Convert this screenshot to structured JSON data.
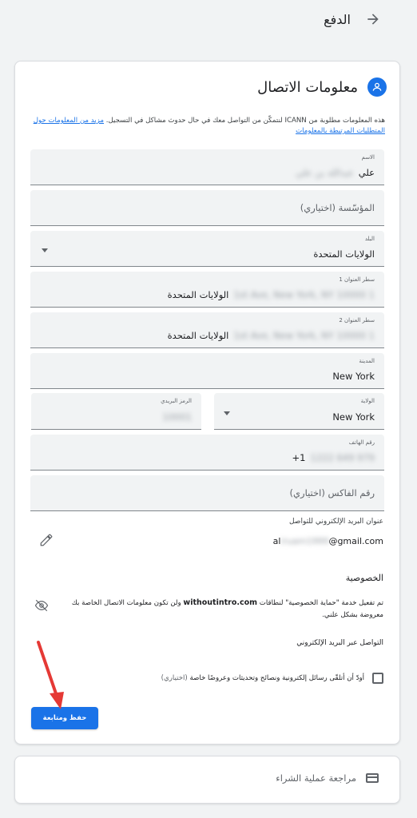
{
  "header": {
    "title": "الدفع",
    "back_icon": "arrow-forward-icon"
  },
  "contact": {
    "title": "معلومات الاتصال",
    "intro_text": "هذه المعلومات مطلوبة من ICANN لنتمكّن من التواصل معك في حال حدوث مشاكل في التسجيل.",
    "intro_link": "مزيد من المعلومات حول المتطلبات المرتبطة بالمعلومات"
  },
  "fields": {
    "name": {
      "label": "الاسم",
      "value_visible": "علي",
      "value_blurred": "عبدالله بن علي"
    },
    "org": {
      "placeholder": "المؤسّسة (اختياري)"
    },
    "country": {
      "label": "البلد",
      "value": "الولايات المتحدة"
    },
    "address1": {
      "label": "سطر العنوان 1",
      "value_visible": "الولايات المتحدة",
      "value_blurred": "1st Ave, New York, NY 10000 1"
    },
    "address2": {
      "label": "سطر العنوان 2",
      "value_visible": "الولايات المتحدة",
      "value_blurred": "1st Ave, New York, NY 10000 1"
    },
    "city": {
      "label": "المدينة",
      "value": "New York"
    },
    "state": {
      "label": "الولاية",
      "value": "New York"
    },
    "zip": {
      "label": "الرمز البريدي",
      "value_blurred": "10001"
    },
    "phone": {
      "label": "رقم الهاتف",
      "value_visible": "1+",
      "value_blurred": "979 649 1222"
    },
    "fax": {
      "placeholder": "رقم الفاكس (اختياري)"
    }
  },
  "email": {
    "label": "عنوان البريد الإلكتروني للتواصل",
    "prefix": "al",
    "blurred": "iruam1999",
    "suffix": "@gmail.com"
  },
  "privacy": {
    "title": "الخصوصية",
    "text_before": "تم تفعيل خدمة \"حماية الخصوصية\" لنطاقات",
    "domain": "withoutintro.com",
    "text_after": "ولن تكون معلومات الاتصال الخاصة بك معروضة بشكل علني."
  },
  "marketing": {
    "title": "التواصل عبر البريد الإلكتروني",
    "checkbox_label": "أودّ أن أتلقّى رسائل إلكترونية ونصائح وتحديثات وعروضًا خاصة",
    "optional": "(اختياري)"
  },
  "save_button": "حفظ ومتابعة",
  "review": {
    "label": "مراجعة عملية الشراء"
  },
  "colors": {
    "accent": "#1a73e8",
    "annotation": "#e53935"
  }
}
